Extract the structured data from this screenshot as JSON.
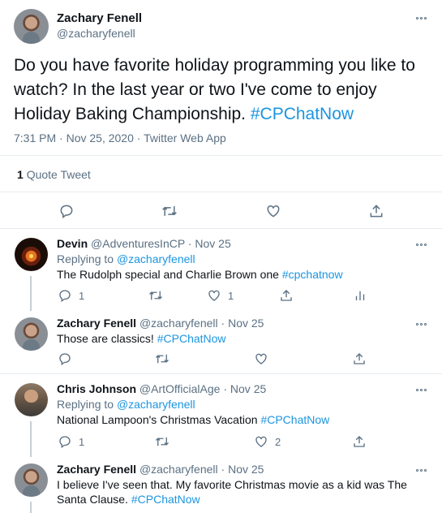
{
  "main_tweet": {
    "author_name": "Zachary Fenell",
    "author_handle": "@zacharyfenell",
    "text": "Do you have favorite holiday programming you like to watch? In the last year or two I've come to enjoy Holiday Baking Championship.",
    "hashtag": "#CPChatNow",
    "time": "7:31 PM",
    "date": "Nov 25, 2020",
    "source": "Twitter Web App",
    "quote_count": "1",
    "quote_label": "Quote Tweet"
  },
  "replies": [
    {
      "author_name": "Devin",
      "author_handle": "@AdventuresInCP",
      "date": "Nov 25",
      "replying_to_label": "Replying to",
      "replying_to": "@zacharyfenell",
      "text": "The Rudolph special and Charlie Brown one",
      "hashtag": "#cpchatnow",
      "reply_count": "1",
      "like_count": "1"
    },
    {
      "author_name": "Zachary Fenell",
      "author_handle": "@zacharyfenell",
      "date": "Nov 25",
      "text": "Those are classics!",
      "hashtag": "#CPChatNow"
    },
    {
      "author_name": "Chris Johnson",
      "author_handle": "@ArtOfficialAge",
      "date": "Nov 25",
      "replying_to_label": "Replying to",
      "replying_to": "@zacharyfenell",
      "text": "National Lampoon's Christmas Vacation",
      "hashtag": "#CPChatNow",
      "reply_count": "1",
      "like_count": "2"
    },
    {
      "author_name": "Zachary Fenell",
      "author_handle": "@zacharyfenell",
      "date": "Nov 25",
      "text": "I believe I've seen that. My favorite Christmas movie as a kid was The Santa Clause.",
      "hashtag": "#CPChatNow"
    }
  ],
  "colors": {
    "link": "#1b95e0",
    "muted": "#5b7083",
    "text": "#0f1419",
    "divider": "#e6ecf0"
  },
  "icons": {
    "reply": "reply-icon",
    "retweet": "retweet-icon",
    "like": "heart-icon",
    "share": "share-icon",
    "analytics": "analytics-icon",
    "more": "more-icon"
  }
}
